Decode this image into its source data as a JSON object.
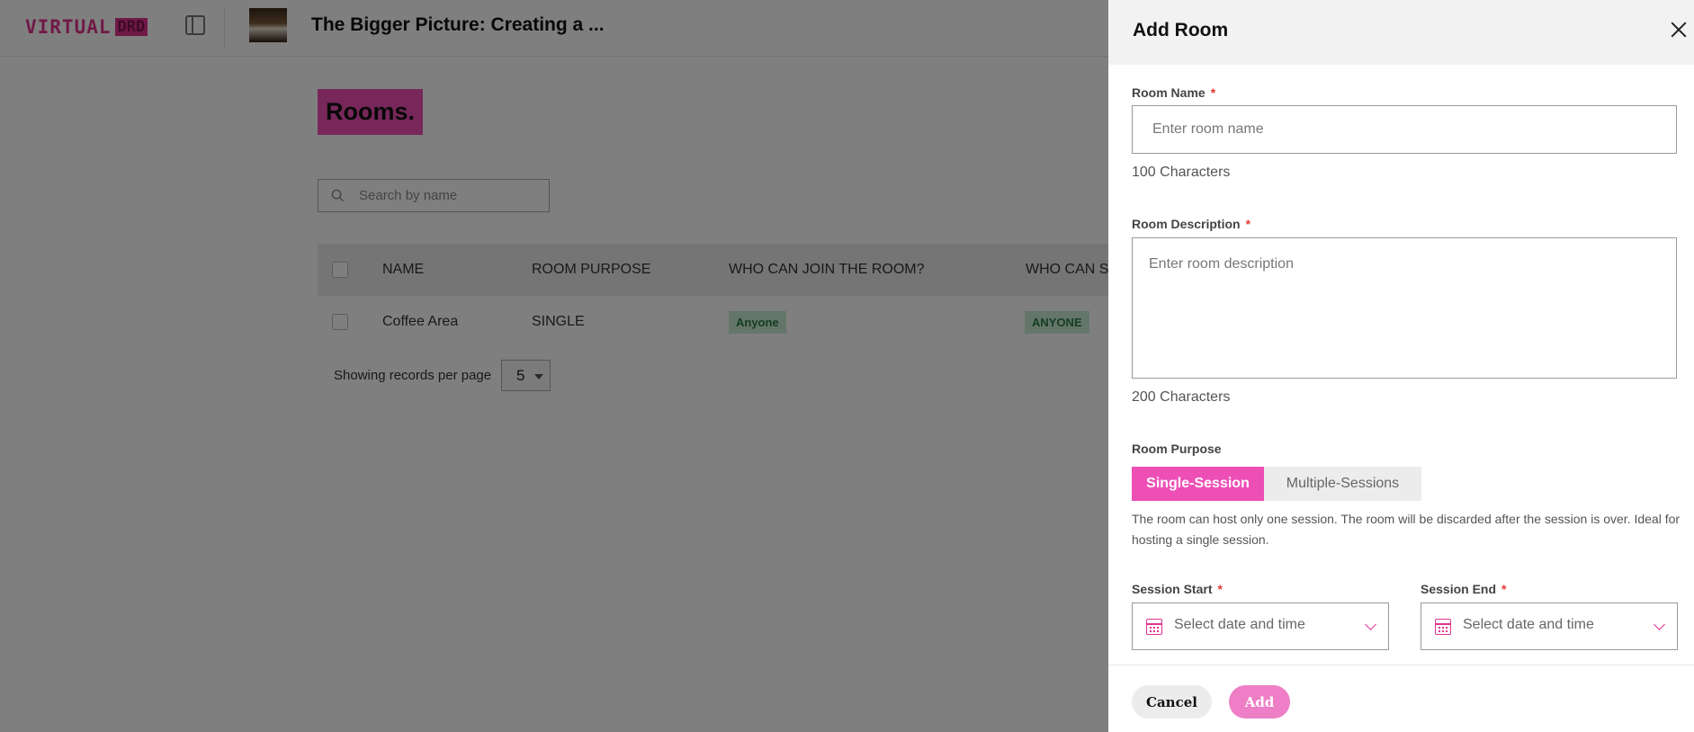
{
  "app": {
    "logo_text": "VIRTUAL",
    "logo_box": "DRD",
    "event_title": "The Bigger Picture: Creating a ..."
  },
  "rooms": {
    "heading": "Rooms.",
    "search_placeholder": "Search by name",
    "columns": [
      "NAME",
      "ROOM PURPOSE",
      "WHO CAN JOIN THE ROOM?",
      "WHO CAN S"
    ],
    "rows": [
      {
        "name": "Coffee Area",
        "purpose": "SINGLE",
        "who_join": "Anyone",
        "who_s": "ANYONE"
      }
    ],
    "pager_label": "Showing records per page",
    "pager_value": "5"
  },
  "drawer": {
    "title": "Add Room",
    "room_name_label": "Room Name",
    "room_name_placeholder": "Enter room name",
    "room_name_hint": "100 Characters",
    "room_desc_label": "Room Description",
    "room_desc_placeholder": "Enter room description",
    "room_desc_hint": "200 Characters",
    "required_mark": "*",
    "purpose_label": "Room Purpose",
    "purpose_options": [
      "Single-Session",
      "Multiple-Sessions"
    ],
    "purpose_selected": "Single-Session",
    "purpose_desc": "The room can host only one session. The room will be discarded after the session is over. Ideal for hosting a single session.",
    "session_start_label": "Session Start",
    "session_end_label": "Session End",
    "date_placeholder": "Select date and time",
    "cancel_label": "Cancel",
    "add_label": "Add"
  },
  "colors": {
    "accent": "#ee4fb5",
    "badge_bg": "#c8edd3",
    "badge_text": "#2d7a44"
  }
}
